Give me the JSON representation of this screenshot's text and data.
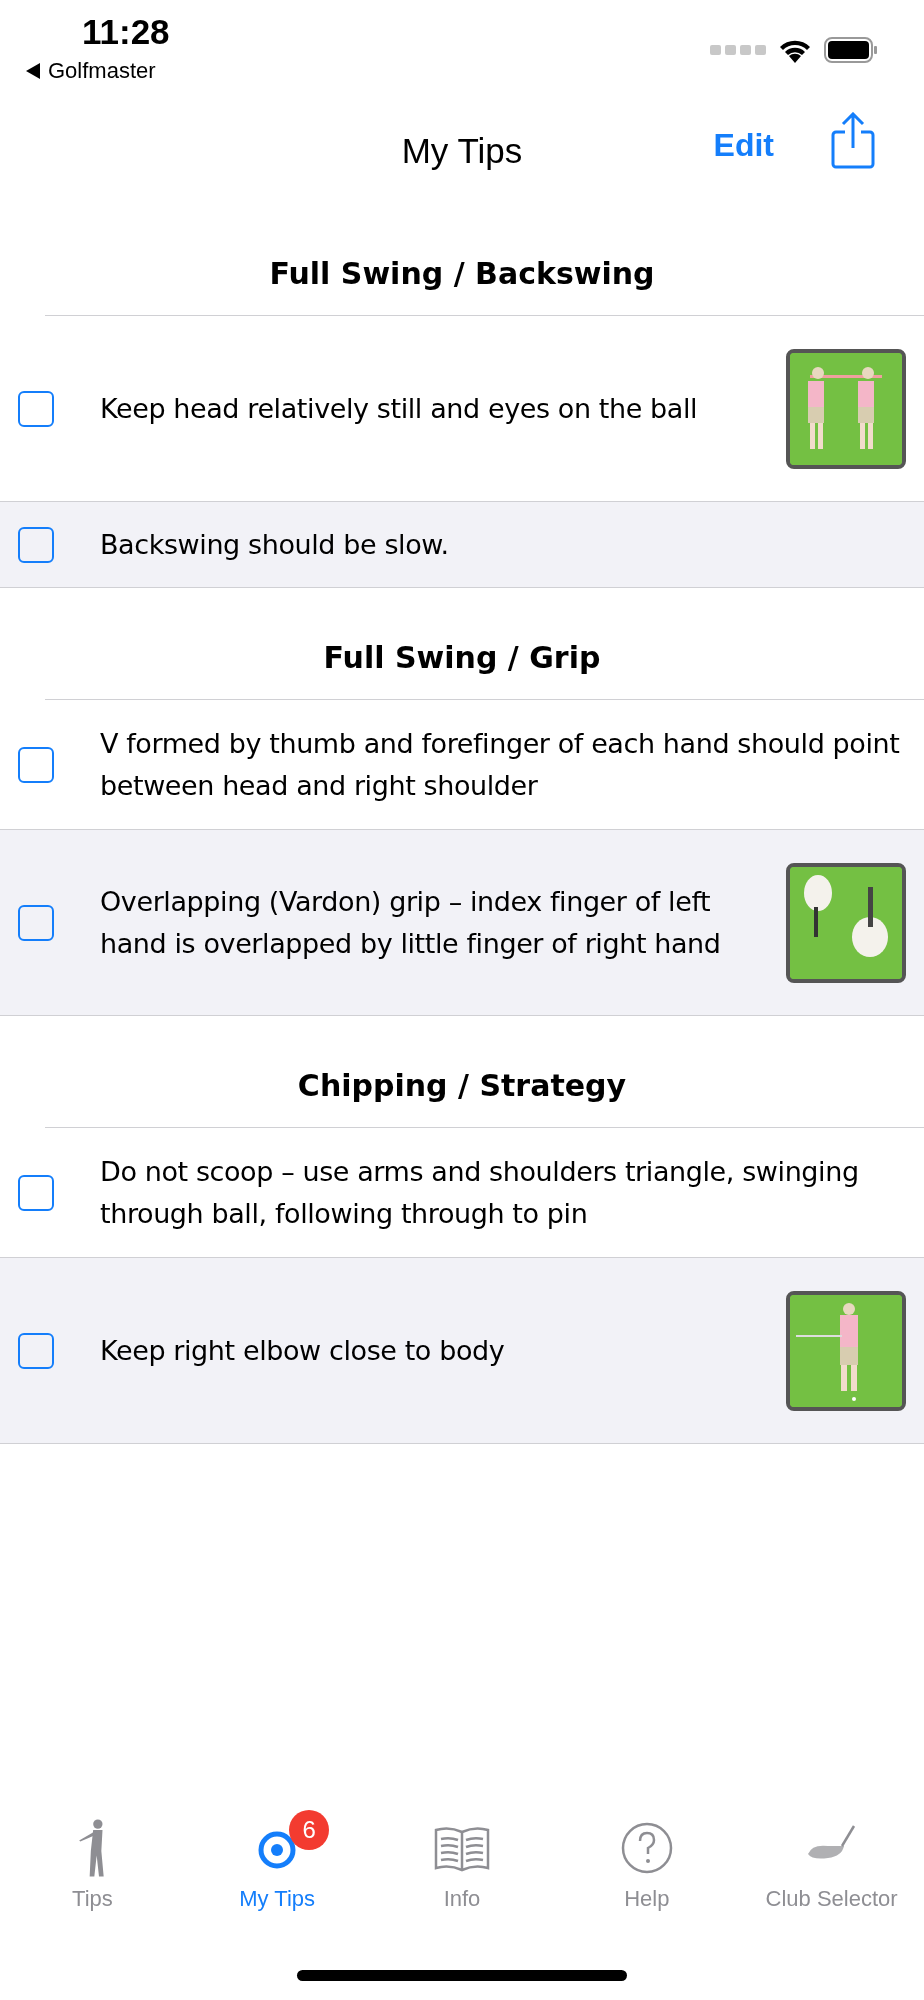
{
  "status_bar": {
    "time": "11:28",
    "back_label": "Golfmaster"
  },
  "nav_bar": {
    "title": "My Tips",
    "edit": "Edit"
  },
  "sections": [
    {
      "title": "Full Swing / Backswing",
      "tips": [
        {
          "text": "Keep head relatively still and eyes on the ball",
          "checked": false
        },
        {
          "text": "Backswing should be slow.",
          "checked": false
        }
      ]
    },
    {
      "title": "Full Swing / Grip",
      "tips": [
        {
          "text": "V formed by thumb and forefinger of each hand should point between head and right shoulder",
          "checked": false
        },
        {
          "text": "Overlapping (Vardon) grip – index finger of left hand is overlapped by little finger of right hand",
          "checked": false
        }
      ]
    },
    {
      "title": "Chipping / Strategy",
      "tips": [
        {
          "text": "Do not scoop – use arms and shoulders triangle, swinging through ball, following through to pin",
          "checked": false
        },
        {
          "text": "Keep right elbow close to body",
          "checked": false
        }
      ]
    }
  ],
  "tab_bar": [
    {
      "label": "Tips",
      "kind": "golfer",
      "selected": false
    },
    {
      "label": "My Tips",
      "kind": "target",
      "selected": true,
      "badge": "6"
    },
    {
      "label": "Info",
      "kind": "book",
      "selected": false
    },
    {
      "label": "Help",
      "kind": "help",
      "selected": false
    },
    {
      "label": "Club Selector",
      "kind": "club",
      "selected": false
    }
  ]
}
